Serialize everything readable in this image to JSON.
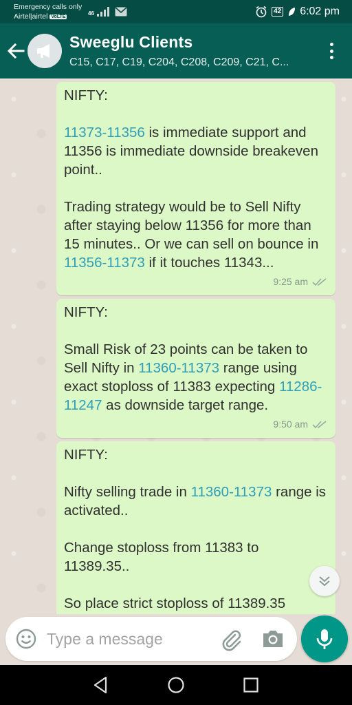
{
  "status_bar": {
    "carrier_line1": "Emergency calls only",
    "carrier_line2": "Airtel|airtel",
    "volte": "VoLTE",
    "network": "46",
    "battery": "42",
    "time": "6:02 pm"
  },
  "header": {
    "title": "Sweeglu Clients",
    "subtitle": "C15, C17, C19, C204, C208, C209, C21, C..."
  },
  "messages": [
    {
      "heading": "NIFTY:",
      "paragraphs": [
        [
          {
            "text": "11373-11356",
            "link": true
          },
          {
            "text": " is immediate support and 11356 is immediate downside breakeven point..",
            "link": false
          }
        ],
        [
          {
            "text": "Trading strategy would be to Sell Nifty after staying below 11356 for more than 15 minutes.. Or we can sell on bounce in ",
            "link": false
          },
          {
            "text": "11356-11373",
            "link": true
          },
          {
            "text": " if it touches 11343...",
            "link": false
          }
        ]
      ],
      "time": "9:25 am"
    },
    {
      "heading": "NIFTY:",
      "paragraphs": [
        [
          {
            "text": "Small Risk of 23 points can be taken to Sell Nifty in ",
            "link": false
          },
          {
            "text": "11360-11373",
            "link": true
          },
          {
            "text": " range using exact stoploss of 11383 expecting ",
            "link": false
          },
          {
            "text": "11286-11247",
            "link": true
          },
          {
            "text": " as downside target range.",
            "link": false
          }
        ]
      ],
      "time": "9:50 am"
    },
    {
      "heading": "NIFTY:",
      "paragraphs": [
        [
          {
            "text": "Nifty selling trade in ",
            "link": false
          },
          {
            "text": "11360-11373",
            "link": true
          },
          {
            "text": " range is activated..",
            "link": false
          }
        ],
        [
          {
            "text": "Change stoploss from 11383 to 11389.35..",
            "link": false
          }
        ],
        [
          {
            "text": "So place strict stoploss of 11389.35",
            "link": false
          }
        ]
      ],
      "time": ""
    }
  ],
  "input": {
    "placeholder": "Type a message"
  },
  "colors": {
    "header": "#075e54",
    "status_bar": "#054c44",
    "bubble_out": "#dcf8c6",
    "link": "#2e9fb8",
    "mic": "#009688"
  }
}
